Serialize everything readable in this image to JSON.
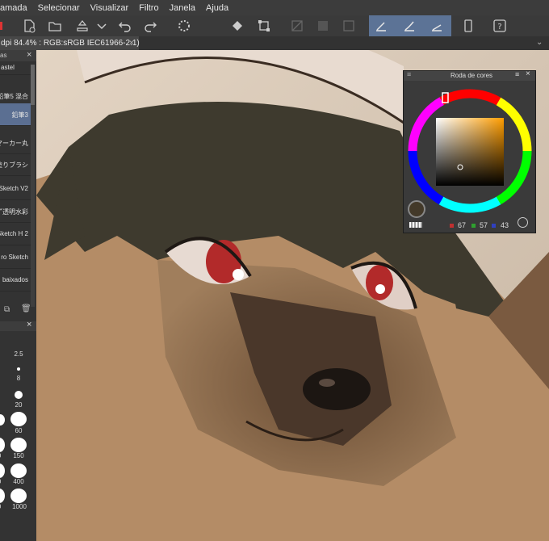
{
  "menu": {
    "items": [
      "amada",
      "Selecionar",
      "Visualizar",
      "Filtro",
      "Janela",
      "Ajuda"
    ]
  },
  "toolbar": {
    "icons": [
      "new-file-icon",
      "open-folder-icon",
      "export-icon",
      "chevron-down-icon",
      "undo-icon",
      "redo-icon",
      "loading-icon",
      "fill-icon",
      "transform-icon",
      "clear-icon",
      "fill-layer-icon",
      "mask-icon",
      "pen-stabilizer-icon",
      "brush-stabilizer-icon",
      "line-stabilizer-icon",
      "smartphone-icon",
      "help-icon"
    ]
  },
  "tab": {
    "title": "dpi 84.4% : RGB:sRGB IEC61966-2.1)",
    "close": "×"
  },
  "brush_panel": {
    "header": "as",
    "close": "×",
    "items": [
      "astel",
      "鉛筆5 混合",
      "鉛筆3",
      "マーカー丸",
      "塗りブラシ",
      "Sketch V2",
      "ず透明水彩",
      "Sketch H 2",
      "ro Sketch",
      "baixados"
    ],
    "selected_index": 2
  },
  "size_panel": {
    "sizes": [
      "2.5",
      "8",
      "20",
      "60",
      "150",
      "400",
      "1000"
    ],
    "partial": [
      "0",
      "0",
      "0"
    ]
  },
  "color_wheel": {
    "title": "Roda de cores",
    "r": "67",
    "g": "57",
    "b": "43",
    "current_color": "#433929",
    "hue_color": "#ff9d00"
  },
  "colors": {
    "accent": "#5c7396",
    "panel": "#3a3a3a"
  }
}
